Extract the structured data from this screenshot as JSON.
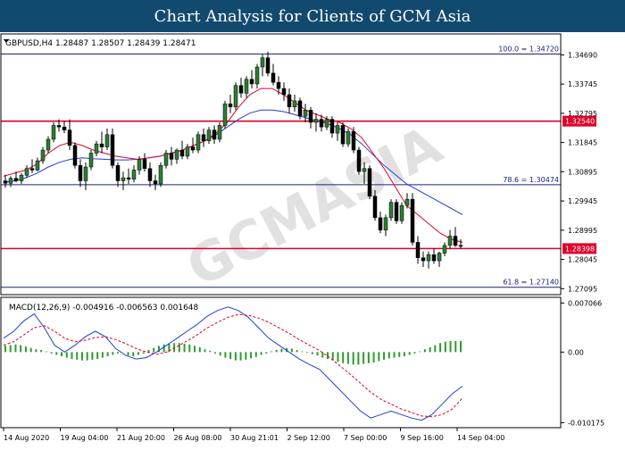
{
  "header": {
    "title": "Chart Analysis for Clients of GCM Asia"
  },
  "watermark": "GCMASIA",
  "chart_data": {
    "type": "candlestick",
    "symbol_info": "GBPUSD,H4  1.28487 1.28507 1.28439 1.28471",
    "price_ylim": [
      1.269,
      1.352
    ],
    "price_ticks": [
      "1.34690",
      "1.33745",
      "1.32795",
      "1.31845",
      "1.30895",
      "1.29945",
      "1.28995",
      "1.28045",
      "1.27095"
    ],
    "fib_levels": [
      {
        "label": "100.0 = 1.34720",
        "value": 1.3472
      },
      {
        "label": "78.6 = 1.30474",
        "value": 1.30474
      },
      {
        "label": "61.8 = 1.27140",
        "value": 1.2714
      }
    ],
    "sr_levels": [
      {
        "label": "1.32540",
        "value": 1.3254
      },
      {
        "label": "1.28398",
        "value": 1.28398
      }
    ],
    "x_labels": [
      "14 Aug 2020",
      "19 Aug 04:00",
      "21 Aug 20:00",
      "26 Aug 08:00",
      "30 Aug 21:01",
      "2 Sep 12:00",
      "7 Sep 00:00",
      "9 Sep 16:00",
      "14 Sep 04:00"
    ],
    "ohlc": [
      [
        1.306,
        1.308,
        1.3038,
        1.3052
      ],
      [
        1.3052,
        1.3075,
        1.304,
        1.3068
      ],
      [
        1.3068,
        1.309,
        1.3055,
        1.306
      ],
      [
        1.306,
        1.3085,
        1.305,
        1.3078
      ],
      [
        1.3078,
        1.311,
        1.307,
        1.31
      ],
      [
        1.31,
        1.313,
        1.3085,
        1.3095
      ],
      [
        1.3095,
        1.3135,
        1.309,
        1.3125
      ],
      [
        1.3125,
        1.317,
        1.3115,
        1.316
      ],
      [
        1.316,
        1.3205,
        1.315,
        1.3195
      ],
      [
        1.3195,
        1.325,
        1.3185,
        1.324
      ],
      [
        1.324,
        1.326,
        1.322,
        1.3235
      ],
      [
        1.3235,
        1.3255,
        1.3215,
        1.3225
      ],
      [
        1.3225,
        1.326,
        1.316,
        1.3175
      ],
      [
        1.3175,
        1.3185,
        1.31,
        1.311
      ],
      [
        1.311,
        1.313,
        1.304,
        1.306
      ],
      [
        1.306,
        1.312,
        1.303,
        1.3105
      ],
      [
        1.3105,
        1.316,
        1.3095,
        1.315
      ],
      [
        1.315,
        1.319,
        1.314,
        1.318
      ],
      [
        1.318,
        1.322,
        1.315,
        1.317
      ],
      [
        1.317,
        1.323,
        1.316,
        1.321
      ],
      [
        1.321,
        1.323,
        1.31,
        1.311
      ],
      [
        1.311,
        1.312,
        1.304,
        1.306
      ],
      [
        1.306,
        1.309,
        1.303,
        1.307
      ],
      [
        1.307,
        1.31,
        1.305,
        1.3065
      ],
      [
        1.3065,
        1.311,
        1.3055,
        1.3095
      ],
      [
        1.3095,
        1.314,
        1.308,
        1.313
      ],
      [
        1.313,
        1.315,
        1.309,
        1.31
      ],
      [
        1.31,
        1.312,
        1.304,
        1.306
      ],
      [
        1.306,
        1.308,
        1.303,
        1.305
      ],
      [
        1.305,
        1.312,
        1.304,
        1.311
      ],
      [
        1.311,
        1.316,
        1.31,
        1.315
      ],
      [
        1.315,
        1.317,
        1.311,
        1.313
      ],
      [
        1.313,
        1.3165,
        1.3115,
        1.316
      ],
      [
        1.316,
        1.319,
        1.313,
        1.314
      ],
      [
        1.314,
        1.318,
        1.313,
        1.317
      ],
      [
        1.317,
        1.32,
        1.315,
        1.316
      ],
      [
        1.316,
        1.322,
        1.315,
        1.321
      ],
      [
        1.321,
        1.323,
        1.317,
        1.319
      ],
      [
        1.319,
        1.3235,
        1.318,
        1.3225
      ],
      [
        1.3225,
        1.324,
        1.318,
        1.3195
      ],
      [
        1.3195,
        1.325,
        1.3185,
        1.324
      ],
      [
        1.324,
        1.332,
        1.323,
        1.331
      ],
      [
        1.331,
        1.334,
        1.328,
        1.33
      ],
      [
        1.33,
        1.338,
        1.329,
        1.337
      ],
      [
        1.337,
        1.3395,
        1.333,
        1.3345
      ],
      [
        1.3345,
        1.34,
        1.333,
        1.339
      ],
      [
        1.339,
        1.342,
        1.336,
        1.3375
      ],
      [
        1.3375,
        1.344,
        1.336,
        1.343
      ],
      [
        1.343,
        1.347,
        1.34,
        1.346
      ],
      [
        1.346,
        1.348,
        1.34,
        1.341
      ],
      [
        1.341,
        1.344,
        1.337,
        1.338
      ],
      [
        1.338,
        1.34,
        1.334,
        1.336
      ],
      [
        1.336,
        1.338,
        1.332,
        1.334
      ],
      [
        1.334,
        1.336,
        1.328,
        1.33
      ],
      [
        1.33,
        1.334,
        1.3285,
        1.332
      ],
      [
        1.332,
        1.333,
        1.326,
        1.327
      ],
      [
        1.327,
        1.331,
        1.325,
        1.329
      ],
      [
        1.329,
        1.33,
        1.323,
        1.325
      ],
      [
        1.325,
        1.328,
        1.322,
        1.326
      ],
      [
        1.326,
        1.3275,
        1.322,
        1.3235
      ],
      [
        1.3235,
        1.327,
        1.3225,
        1.326
      ],
      [
        1.326,
        1.327,
        1.32,
        1.3215
      ],
      [
        1.3215,
        1.325,
        1.319,
        1.324
      ],
      [
        1.324,
        1.325,
        1.317,
        1.318
      ],
      [
        1.318,
        1.323,
        1.317,
        1.322
      ],
      [
        1.322,
        1.3235,
        1.315,
        1.316
      ],
      [
        1.316,
        1.317,
        1.308,
        1.309
      ],
      [
        1.309,
        1.312,
        1.305,
        1.31
      ],
      [
        1.31,
        1.311,
        1.3,
        1.301
      ],
      [
        1.301,
        1.303,
        1.293,
        1.294
      ],
      [
        1.294,
        1.296,
        1.289,
        1.29
      ],
      [
        1.29,
        1.295,
        1.288,
        1.294
      ],
      [
        1.294,
        1.3,
        1.293,
        1.299
      ],
      [
        1.299,
        1.3,
        1.292,
        1.293
      ],
      [
        1.293,
        1.299,
        1.292,
        1.298
      ],
      [
        1.298,
        1.302,
        1.297,
        1.3
      ],
      [
        1.3,
        1.302,
        1.285,
        1.286
      ],
      [
        1.286,
        1.288,
        1.279,
        1.281
      ],
      [
        1.281,
        1.283,
        1.278,
        1.28
      ],
      [
        1.28,
        1.283,
        1.2775,
        1.282
      ],
      [
        1.282,
        1.284,
        1.279,
        1.28
      ],
      [
        1.28,
        1.283,
        1.278,
        1.2825
      ],
      [
        1.2825,
        1.286,
        1.2815,
        1.285
      ],
      [
        1.285,
        1.29,
        1.284,
        1.288
      ],
      [
        1.288,
        1.291,
        1.2845,
        1.285
      ],
      [
        1.285,
        1.287,
        1.284,
        1.2847
      ]
    ],
    "ma_fast": [
      1.3075,
      1.3085,
      1.3095,
      1.3115,
      1.315,
      1.3175,
      1.3185,
      1.3175,
      1.316,
      1.315,
      1.314,
      1.3135,
      1.313,
      1.3135,
      1.314,
      1.315,
      1.316,
      1.3175,
      1.319,
      1.3215,
      1.325,
      1.33,
      1.334,
      1.336,
      1.336,
      1.334,
      1.3315,
      1.329,
      1.3275,
      1.326,
      1.325,
      1.323,
      1.32,
      1.315,
      1.31,
      1.304,
      1.298,
      1.295,
      1.292,
      1.289,
      1.287,
      1.286
    ],
    "ma_slow": [
      1.3055,
      1.306,
      1.307,
      1.3085,
      1.3105,
      1.312,
      1.313,
      1.3135,
      1.3132,
      1.313,
      1.3128,
      1.3128,
      1.313,
      1.3135,
      1.314,
      1.315,
      1.316,
      1.3175,
      1.319,
      1.321,
      1.3235,
      1.326,
      1.328,
      1.329,
      1.329,
      1.3285,
      1.3275,
      1.3265,
      1.3255,
      1.3245,
      1.323,
      1.321,
      1.318,
      1.3145,
      1.311,
      1.308,
      1.305,
      1.303,
      1.301,
      1.299,
      1.297,
      1.295
    ],
    "macd": {
      "label": "MACD(12,26,9) -0.004916 -0.006563 0.001648",
      "ylim": [
        -0.0105,
        0.0075
      ],
      "ticks": [
        "0.007066",
        "0.00",
        "-0.010175"
      ],
      "macd_line": [
        0.002,
        0.003,
        0.0045,
        0.0055,
        0.0035,
        0.001,
        0.0,
        0.001,
        0.0022,
        0.003,
        0.0022,
        0.0005,
        -0.0005,
        -0.001,
        -0.0008,
        0.0,
        0.001,
        0.002,
        0.003,
        0.004,
        0.0052,
        0.006,
        0.0065,
        0.006,
        0.005,
        0.0035,
        0.002,
        0.001,
        0.0,
        -0.001,
        -0.0018,
        -0.0025,
        -0.004,
        -0.0055,
        -0.007,
        -0.0085,
        -0.0095,
        -0.009,
        -0.0085,
        -0.009,
        -0.0095,
        -0.0098,
        -0.009,
        -0.0075,
        -0.006,
        -0.0049
      ],
      "signal_line": [
        0.001,
        0.0015,
        0.0025,
        0.0035,
        0.0038,
        0.003,
        0.002,
        0.0015,
        0.0017,
        0.0021,
        0.0022,
        0.0018,
        0.0012,
        0.0005,
        0.0,
        -0.0003,
        0.0,
        0.0008,
        0.0016,
        0.0025,
        0.0035,
        0.0043,
        0.005,
        0.0054,
        0.0053,
        0.0049,
        0.0043,
        0.0035,
        0.0027,
        0.0018,
        0.001,
        0.0002,
        -0.0008,
        -0.002,
        -0.0032,
        -0.0045,
        -0.0058,
        -0.0068,
        -0.0075,
        -0.0082,
        -0.0087,
        -0.0092,
        -0.0093,
        -0.009,
        -0.0082,
        -0.0066
      ],
      "histogram": [
        0.0009,
        0.001,
        0.0011,
        0.001,
        0.0008,
        0.0006,
        0.0004,
        0.0003,
        0.0001,
        -0.0002,
        -0.0004,
        -0.0006,
        -0.0008,
        -0.001,
        -0.0011,
        -0.0012,
        -0.0012,
        -0.0011,
        -0.001,
        -0.0008,
        -0.0006,
        -0.0004,
        -0.0002,
        0.0,
        -0.0005,
        -0.0006,
        -0.0004,
        -0.0002,
        0.0003,
        0.0006,
        0.0009,
        0.0011,
        0.0012,
        0.0013,
        0.0013,
        0.0012,
        0.0011,
        0.0009,
        0.0007,
        0.0004,
        0.0002,
        -0.0002,
        -0.0005,
        -0.0008,
        -0.001,
        -0.0012,
        -0.0012,
        -0.0011,
        -0.0009,
        -0.0007,
        -0.0004,
        -0.0002,
        0.0001,
        0.0003,
        0.0005,
        0.0006,
        0.0005,
        0.0003,
        0.0001,
        -0.0001,
        -0.0003,
        -0.0005,
        -0.0008,
        -0.001,
        -0.0012,
        -0.0014,
        -0.0016,
        -0.0017,
        -0.0018,
        -0.0018,
        -0.0017,
        -0.0016,
        -0.0015,
        -0.0013,
        -0.0011,
        -0.0009,
        -0.0008,
        -0.0007,
        -0.0006,
        -0.0004,
        -0.0002,
        0.0001,
        0.0004,
        0.0007,
        0.001,
        0.0013,
        0.0015,
        0.0016,
        0.0016,
        0.0016
      ]
    }
  }
}
